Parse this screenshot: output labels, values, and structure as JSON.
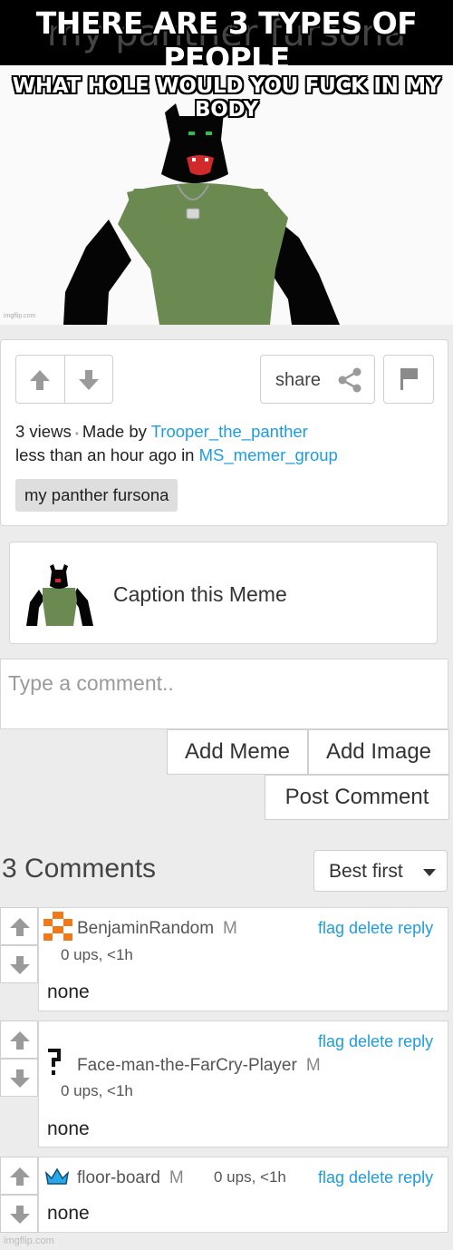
{
  "caption": {
    "top_text": "THERE ARE 3 TYPES OF PEOPLE",
    "behind_text": "my panther fursona"
  },
  "meme": {
    "headline": "WHAT HOLE WOULD YOU FUCK IN MY BODY",
    "watermark": "imgflip.com"
  },
  "info": {
    "share_label": "share",
    "views_text": "3 views",
    "made_by_text": "Made by",
    "author": "Trooper_the_panther",
    "time_text": "less than an hour ago in",
    "group": "MS_memer_group",
    "tag": "my panther fursona"
  },
  "caption_card": {
    "label": "Caption this Meme"
  },
  "comment_form": {
    "placeholder": "Type a comment..",
    "add_meme_label": "Add Meme",
    "add_image_label": "Add Image",
    "post_label": "Post Comment"
  },
  "comments_header": {
    "count_label": "3 Comments",
    "sort_label": "Best first"
  },
  "comments": [
    {
      "user": "BenjaminRandom",
      "badge": "M",
      "ups": "0 ups, <1h",
      "text": "none",
      "avatar": "orange-pixel-avatar-icon"
    },
    {
      "user": "Face-man-the-FarCry-Player",
      "badge": "M",
      "ups": "0 ups, <1h",
      "text": "none",
      "avatar": "question-mark-avatar-icon"
    },
    {
      "user": "floor-board",
      "badge": "M",
      "ups": "0 ups, <1h",
      "text": "none",
      "avatar": "crown-avatar-icon"
    }
  ],
  "comment_actions": {
    "flag": "flag",
    "delete": "delete",
    "reply": "reply"
  },
  "footer": {
    "watermark": "imgflip.com"
  },
  "colors": {
    "link": "#1e9ce0",
    "background": "#ececec",
    "fursona_shirt": "#6a8a52"
  }
}
